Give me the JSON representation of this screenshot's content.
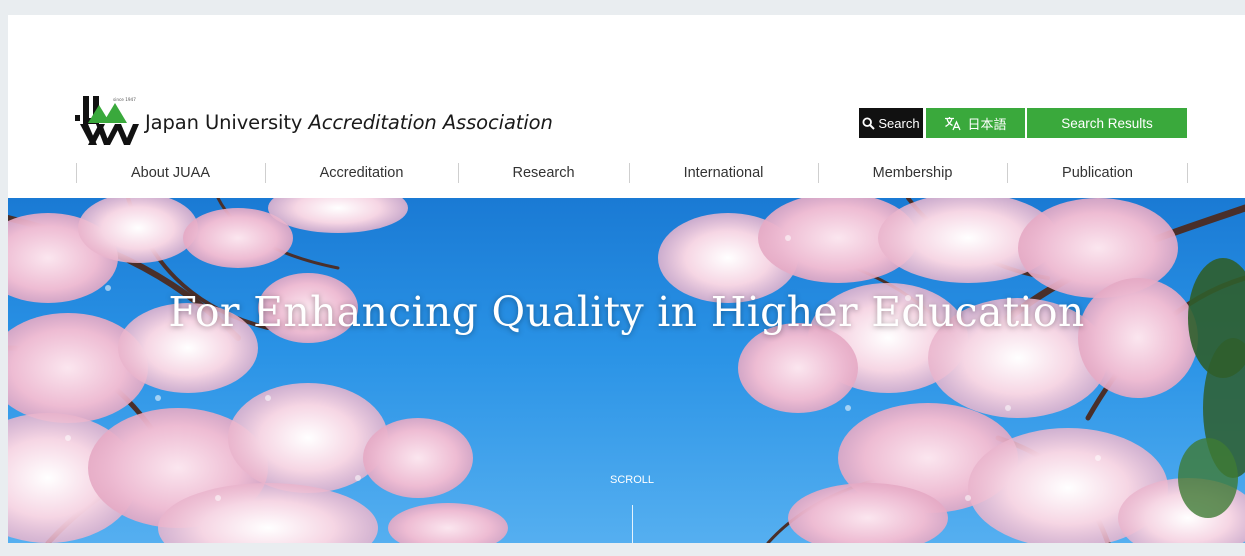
{
  "header": {
    "logo_text_prefix": "Japan University ",
    "logo_text_accreditation": "Accreditation",
    "logo_text_mid": " ",
    "logo_text_association": "Association",
    "logo_since": "since 1947"
  },
  "toolbar": {
    "search_label": "Search",
    "language_label": "日本語",
    "results_label": "Search Results"
  },
  "nav": {
    "items": [
      {
        "label": "About JUAA"
      },
      {
        "label": "Accreditation"
      },
      {
        "label": "Research"
      },
      {
        "label": "International"
      },
      {
        "label": "Membership"
      },
      {
        "label": "Publication"
      }
    ]
  },
  "hero": {
    "tagline": "For Enhancing Quality in Higher Education",
    "scroll_label": "SCROLL"
  },
  "colors": {
    "brand_green": "#3aa93c",
    "search_black": "#111111",
    "sky_blue": "#2a93e6",
    "blossom_pink": "#f3cfe0"
  }
}
